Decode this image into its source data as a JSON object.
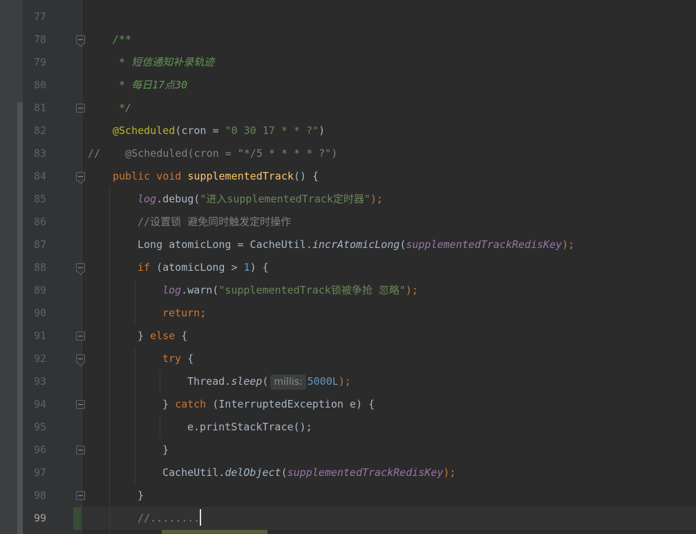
{
  "editor": {
    "lines": [
      {
        "n": "77"
      },
      {
        "n": "78",
        "doc": "/**"
      },
      {
        "n": "79",
        "doc": " * 短信通知补录轨迹"
      },
      {
        "n": "80",
        "doc": " * 每日17点30"
      },
      {
        "n": "81",
        "doc": " */"
      },
      {
        "n": "82",
        "ann": "@Scheduled",
        "p1": "(cron = ",
        "str": "\"0 30 17 * * ?\"",
        "p2": ")"
      },
      {
        "n": "83",
        "cmt": "//    @Scheduled(cron = \"*/5 * * * * ?\")"
      },
      {
        "n": "84",
        "kw": "public void ",
        "fn": "supplementedTrack",
        "p1": "() {"
      },
      {
        "n": "85",
        "field": "log",
        "p1": ".debug(",
        "str": "\"进入supplementedTrack定时器\"",
        "p2": ");"
      },
      {
        "n": "86",
        "cmt": "//设置锁 避免同时触发定时操作"
      },
      {
        "n": "87",
        "p1": "Long atomicLong = CacheUtil.",
        "static": "incrAtomicLong",
        "p2": "(",
        "field": "supplementedTrackRedisKey",
        "p3": ");"
      },
      {
        "n": "88",
        "kw": "if ",
        "p1": "(atomicLong > ",
        "num": "1",
        "p2": ") {"
      },
      {
        "n": "89",
        "field": "log",
        "p1": ".warn(",
        "str": "\"supplementedTrack锁被争抢 忽略\"",
        "p2": ");"
      },
      {
        "n": "90",
        "kw": "return",
        "p1": ";"
      },
      {
        "n": "91",
        "p1": "} ",
        "kw": "else ",
        "p2": "{"
      },
      {
        "n": "92",
        "kw": "try ",
        "p1": "{"
      },
      {
        "n": "93",
        "p1": "Thread.",
        "static": "sleep",
        "p2": "(",
        "hint": "millis:",
        "num": "5000L",
        "p3": ");"
      },
      {
        "n": "94",
        "p1": "} ",
        "kw": "catch ",
        "p2": "(InterruptedException e) {"
      },
      {
        "n": "95",
        "p1": "e.printStackTrace();"
      },
      {
        "n": "96",
        "p1": "}"
      },
      {
        "n": "97",
        "p1": "CacheUtil.",
        "static": "delObject",
        "p2": "(",
        "field": "supplementedTrackRedisKey",
        "p3": ");"
      },
      {
        "n": "98",
        "p1": "}"
      },
      {
        "n": "99",
        "cmt": "//........"
      }
    ]
  },
  "colors": {
    "background": "#2b2b2b",
    "keyword": "#cc7832",
    "string": "#6a8759",
    "annotation": "#bbb529",
    "method_declaration": "#ffc66d",
    "field": "#9876aa",
    "number": "#6897bb",
    "doc_comment": "#629755",
    "comment": "#808080"
  }
}
